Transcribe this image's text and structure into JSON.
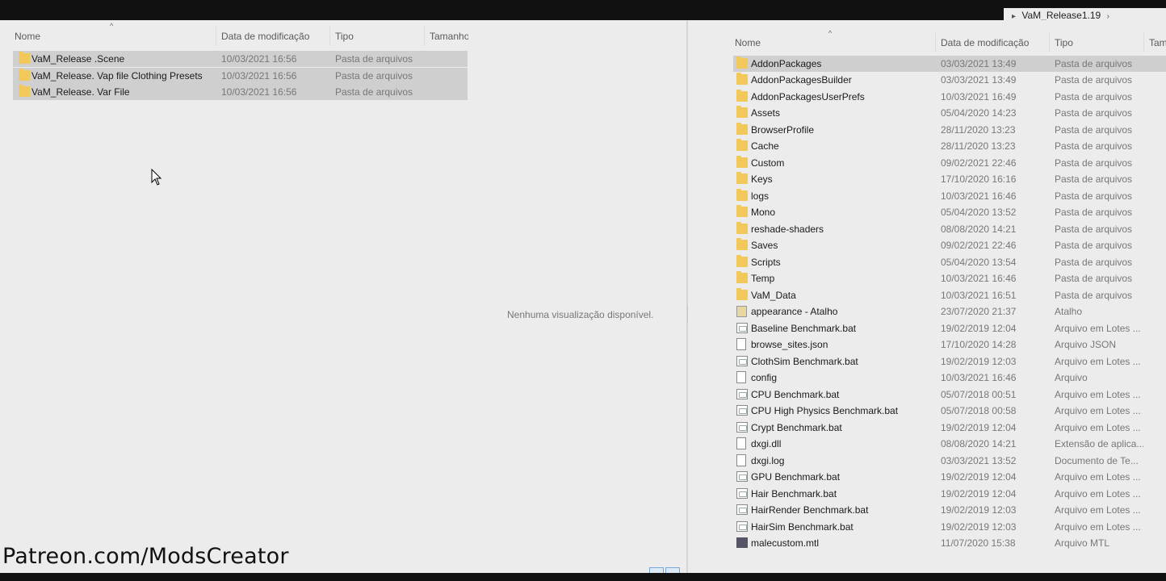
{
  "breadcrumb": {
    "folder": "VaM_Release1.19"
  },
  "left": {
    "headers": {
      "name": "Nome",
      "date": "Data de modificação",
      "type": "Tipo",
      "size": "Tamanho"
    },
    "rows": [
      {
        "name": "VaM_Release .Scene",
        "date": "10/03/2021 16:56",
        "type": "Pasta de arquivos"
      },
      {
        "name": "VaM_Release. Vap file Clothing Presets",
        "date": "10/03/2021 16:56",
        "type": "Pasta de arquivos"
      },
      {
        "name": "VaM_Release. Var File",
        "date": "10/03/2021 16:56",
        "type": "Pasta de arquivos"
      }
    ],
    "preview": "Nenhuma visualização disponível."
  },
  "right": {
    "headers": {
      "name": "Nome",
      "date": "Data de modificação",
      "type": "Tipo",
      "size": "Tama"
    },
    "rows": [
      {
        "name": "AddonPackages",
        "date": "03/03/2021 13:49",
        "type": "Pasta de arquivos",
        "icon": "folder-icon"
      },
      {
        "name": "AddonPackagesBuilder",
        "date": "03/03/2021 13:49",
        "type": "Pasta de arquivos",
        "icon": "folder-icon"
      },
      {
        "name": "AddonPackagesUserPrefs",
        "date": "10/03/2021 16:49",
        "type": "Pasta de arquivos",
        "icon": "folder-icon"
      },
      {
        "name": "Assets",
        "date": "05/04/2020 14:23",
        "type": "Pasta de arquivos",
        "icon": "folder-icon"
      },
      {
        "name": "BrowserProfile",
        "date": "28/11/2020 13:23",
        "type": "Pasta de arquivos",
        "icon": "folder-icon"
      },
      {
        "name": "Cache",
        "date": "28/11/2020 13:23",
        "type": "Pasta de arquivos",
        "icon": "folder-icon"
      },
      {
        "name": "Custom",
        "date": "09/02/2021 22:46",
        "type": "Pasta de arquivos",
        "icon": "folder-icon"
      },
      {
        "name": "Keys",
        "date": "17/10/2020 16:16",
        "type": "Pasta de arquivos",
        "icon": "folder-icon"
      },
      {
        "name": "logs",
        "date": "10/03/2021 16:46",
        "type": "Pasta de arquivos",
        "icon": "folder-icon"
      },
      {
        "name": "Mono",
        "date": "05/04/2020 13:52",
        "type": "Pasta de arquivos",
        "icon": "folder-icon"
      },
      {
        "name": "reshade-shaders",
        "date": "08/08/2020 14:21",
        "type": "Pasta de arquivos",
        "icon": "folder-icon"
      },
      {
        "name": "Saves",
        "date": "09/02/2021 22:46",
        "type": "Pasta de arquivos",
        "icon": "folder-icon"
      },
      {
        "name": "Scripts",
        "date": "05/04/2020 13:54",
        "type": "Pasta de arquivos",
        "icon": "folder-icon"
      },
      {
        "name": "Temp",
        "date": "10/03/2021 16:46",
        "type": "Pasta de arquivos",
        "icon": "folder-icon"
      },
      {
        "name": "VaM_Data",
        "date": "10/03/2021 16:51",
        "type": "Pasta de arquivos",
        "icon": "folder-icon"
      },
      {
        "name": "appearance - Atalho",
        "date": "23/07/2020 21:37",
        "type": "Atalho",
        "icon": "shortcut-icon"
      },
      {
        "name": "Baseline Benchmark.bat",
        "date": "19/02/2019 12:04",
        "type": "Arquivo em Lotes ...",
        "icon": "batch-file-icon"
      },
      {
        "name": "browse_sites.json",
        "date": "17/10/2020 14:28",
        "type": "Arquivo JSON",
        "icon": "document-icon"
      },
      {
        "name": "ClothSim Benchmark.bat",
        "date": "19/02/2019 12:03",
        "type": "Arquivo em Lotes ...",
        "icon": "batch-file-icon"
      },
      {
        "name": "config",
        "date": "10/03/2021 16:46",
        "type": "Arquivo",
        "icon": "document-icon"
      },
      {
        "name": "CPU Benchmark.bat",
        "date": "05/07/2018 00:51",
        "type": "Arquivo em Lotes ...",
        "icon": "batch-file-icon"
      },
      {
        "name": "CPU High Physics Benchmark.bat",
        "date": "05/07/2018 00:58",
        "type": "Arquivo em Lotes ...",
        "icon": "batch-file-icon"
      },
      {
        "name": "Crypt Benchmark.bat",
        "date": "19/02/2019 12:04",
        "type": "Arquivo em Lotes ...",
        "icon": "batch-file-icon"
      },
      {
        "name": "dxgi.dll",
        "date": "08/08/2020 14:21",
        "type": "Extensão de aplica...",
        "icon": "dll-file-icon"
      },
      {
        "name": "dxgi.log",
        "date": "03/03/2021 13:52",
        "type": "Documento de Te...",
        "icon": "document-icon"
      },
      {
        "name": "GPU Benchmark.bat",
        "date": "19/02/2019 12:04",
        "type": "Arquivo em Lotes ...",
        "icon": "batch-file-icon"
      },
      {
        "name": "Hair Benchmark.bat",
        "date": "19/02/2019 12:04",
        "type": "Arquivo em Lotes ...",
        "icon": "batch-file-icon"
      },
      {
        "name": "HairRender Benchmark.bat",
        "date": "19/02/2019 12:03",
        "type": "Arquivo em Lotes ...",
        "icon": "batch-file-icon"
      },
      {
        "name": "HairSim Benchmark.bat",
        "date": "19/02/2019 12:03",
        "type": "Arquivo em Lotes ...",
        "icon": "batch-file-icon"
      },
      {
        "name": "malecustom.mtl",
        "date": "11/07/2020 15:38",
        "type": "Arquivo MTL",
        "icon": "mtl-file-icon"
      }
    ]
  },
  "watermark": "Patreon.com/ModsCreator"
}
